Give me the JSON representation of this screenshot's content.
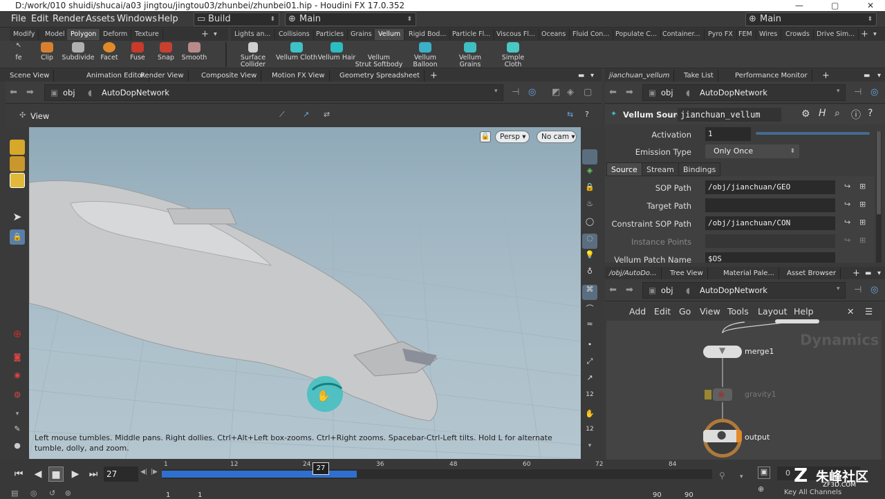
{
  "window": {
    "title": "D:/work/010 shuidi/shucai/a03 jingtou/jingtou03/zhunbei/zhunbei01.hip - Houdini FX 17.0.352"
  },
  "menubar": {
    "items": [
      "File",
      "Edit",
      "Render",
      "Assets",
      "Windows",
      "Help"
    ],
    "desktop": "Build",
    "main1": "Main",
    "main2": "Main"
  },
  "shelf_tabs_left": [
    "Modify",
    "Model",
    "Polygon",
    "Deform",
    "Texture"
  ],
  "shelf_tabs_right": [
    "Lights an...",
    "Collisions",
    "Particles",
    "Grains",
    "Vellum",
    "Rigid Bod...",
    "Particle Fl...",
    "Viscous Fl...",
    "Oceans",
    "Fluid Con...",
    "Populate C...",
    "Container...",
    "Pyro FX",
    "FEM",
    "Wires",
    "Crowds",
    "Drive Sim..."
  ],
  "shelf_tools_left": [
    "fe",
    "Clip",
    "Subdivide",
    "Facet",
    "Fuse",
    "Snap",
    "Smooth"
  ],
  "shelf_tools_right": [
    {
      "l1": "Surface",
      "l2": "Collider"
    },
    {
      "l1": "Vellum Cloth",
      "l2": ""
    },
    {
      "l1": "Vellum Hair",
      "l2": ""
    },
    {
      "l1": "Vellum",
      "l2": "Strut Softbody"
    },
    {
      "l1": "Vellum",
      "l2": "Balloon"
    },
    {
      "l1": "Vellum Grains",
      "l2": ""
    },
    {
      "l1": "Simple Cloth",
      "l2": ""
    }
  ],
  "left_panel_tabs": [
    "Scene View",
    "Animation Editor",
    "Render View",
    "Composite View",
    "Motion FX View",
    "Geometry Spreadsheet"
  ],
  "left_path": {
    "root": "obj",
    "node": "AutoDopNetwork"
  },
  "viewport": {
    "label": "View",
    "persp": "Persp",
    "cam": "No cam",
    "status": "Left mouse tumbles. Middle pans. Right dollies. Ctrl+Alt+Left box-zooms. Ctrl+Right zooms. Spacebar-Ctrl-Left tilts. Hold L for alternate tumble, dolly, and zoom."
  },
  "right_panel_tabs": [
    "jianchuan_vellum",
    "Take List",
    "Performance Monitor"
  ],
  "right_path": {
    "root": "obj",
    "node": "AutoDopNetwork"
  },
  "params": {
    "node_type": "Vellum Source",
    "node_name": "jianchuan_vellum",
    "activation_label": "Activation",
    "activation_value": "1",
    "emission_label": "Emission Type",
    "emission_value": "Only Once",
    "subtabs": [
      "Source",
      "Stream",
      "Bindings"
    ],
    "rows": [
      {
        "label": "SOP Path",
        "value": "/obj/jianchuan/GEO"
      },
      {
        "label": "Target Path",
        "value": ""
      },
      {
        "label": "Constraint SOP Path",
        "value": "/obj/jianchuan/CON"
      },
      {
        "label": "Instance Points",
        "value": ""
      },
      {
        "label": "Vellum Patch Name",
        "value": "$OS"
      }
    ]
  },
  "net_tabs": [
    "/obj/AutoDo...",
    "Tree View",
    "Material Pale...",
    "Asset Browser"
  ],
  "net_path": {
    "root": "obj",
    "node": "AutoDopNetwork"
  },
  "net_menu": [
    "Add",
    "Edit",
    "Go",
    "View",
    "Tools",
    "Layout",
    "Help"
  ],
  "net": {
    "watermark": "Dynamics",
    "nodes": [
      "merge1",
      "gravity1",
      "output"
    ]
  },
  "timeline": {
    "frame": "27",
    "current": "27",
    "ticks": [
      "1",
      "12",
      "24",
      "36",
      "48",
      "60",
      "72",
      "84"
    ],
    "start": "1",
    "start2": "1",
    "end1": "90",
    "end2": "90",
    "key_all": "Key All Channels",
    "brand": "朱峰社区",
    "brand_url": "ZF3D.COM",
    "zero": "0"
  }
}
